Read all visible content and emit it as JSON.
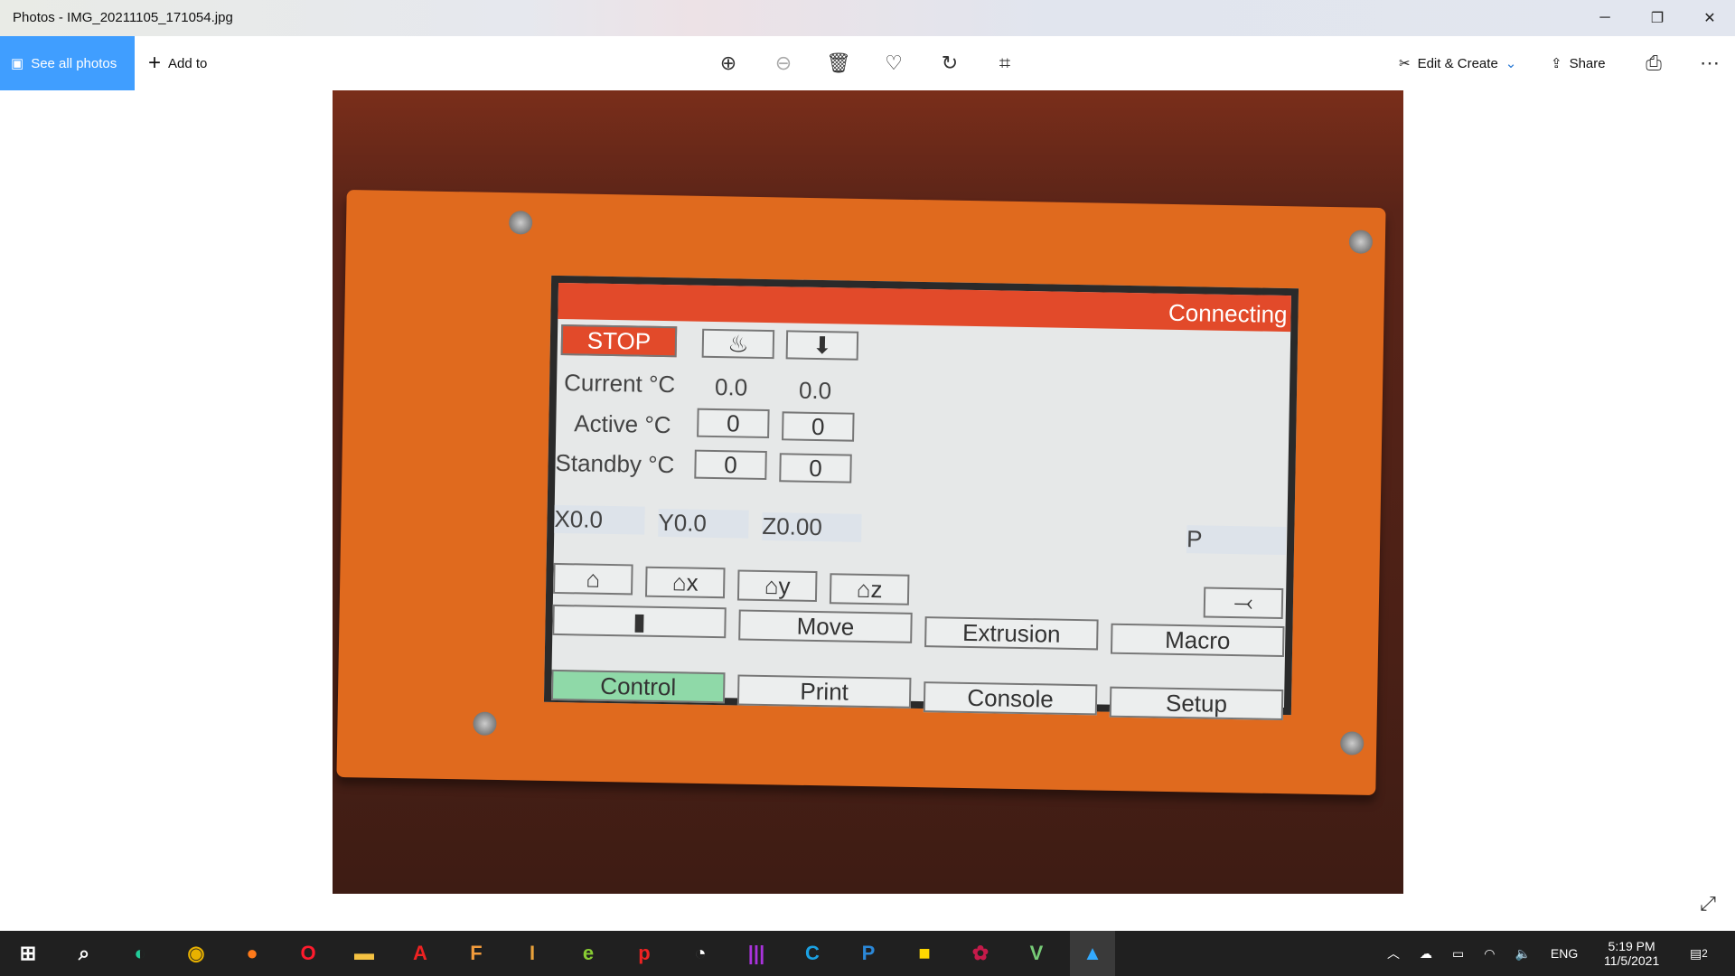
{
  "window": {
    "title": "Photos - IMG_20211105_171054.jpg"
  },
  "toolbar": {
    "see_all": "See all photos",
    "add_to": "Add to",
    "edit_create": "Edit & Create",
    "share": "Share"
  },
  "lcd": {
    "status": "Connecting",
    "stop": "STOP",
    "current_label": "Current °C",
    "active_label": "Active °C",
    "standby_label": "Standby °C",
    "current": [
      "0.0",
      "0.0"
    ],
    "active": [
      "0",
      "0"
    ],
    "standby": [
      "0",
      "0"
    ],
    "x": "X0.0",
    "y": "Y0.0",
    "z": "Z0.00",
    "p": "P",
    "actions": [
      "Move",
      "Extrusion",
      "Macro"
    ],
    "tabs": [
      "Control",
      "Print",
      "Console",
      "Setup"
    ],
    "colors": {
      "header": "#e24a2a",
      "active_tab": "#8fd9a8",
      "frame": "#e06a1e"
    }
  },
  "taskbar": {
    "icons": [
      "start",
      "search",
      "edge",
      "chrome",
      "firefox",
      "opera",
      "file-explorer",
      "acrobat",
      "fusion",
      "inventor",
      "eagle",
      "app-p",
      "app-circle",
      "app-bars",
      "app-c",
      "app-p-blue",
      "sticky-notes",
      "raspberry-pi",
      "app-v",
      "photos"
    ],
    "lang": "ENG",
    "time": "5:19 PM",
    "date": "11/5/2021",
    "notifications": "2"
  }
}
